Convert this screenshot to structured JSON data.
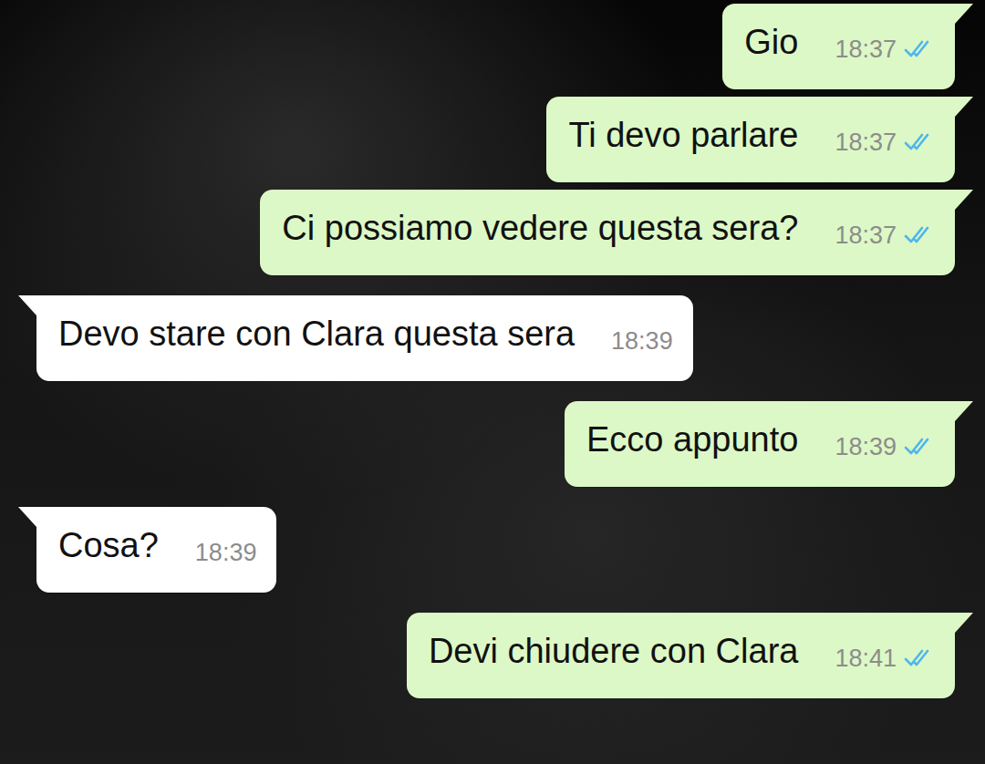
{
  "messages": [
    {
      "text": "Gio",
      "time": "18:37",
      "outgoing": true,
      "read": true
    },
    {
      "text": "Ti devo parlare",
      "time": "18:37",
      "outgoing": true,
      "read": true
    },
    {
      "text": "Ci possiamo vedere questa sera?",
      "time": "18:37",
      "outgoing": true,
      "read": true
    },
    {
      "text": "Devo stare con Clara questa sera",
      "time": "18:39",
      "outgoing": false
    },
    {
      "text": "Ecco appunto",
      "time": "18:39",
      "outgoing": true,
      "read": true
    },
    {
      "text": "Cosa?",
      "time": "18:39",
      "outgoing": false
    },
    {
      "text": "Devi chiudere con Clara",
      "time": "18:41",
      "outgoing": true,
      "read": true
    }
  ]
}
